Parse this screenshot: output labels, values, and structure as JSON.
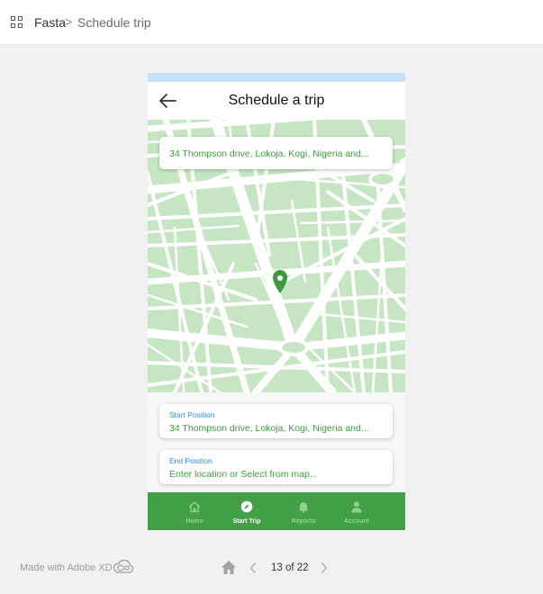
{
  "breadcrumb": {
    "root": "Fasta",
    "separator": ">",
    "current": "Schedule trip"
  },
  "screen": {
    "title": "Schedule a trip",
    "search_value": "34 Thompson drive, Lokoja, Kogi, Nigeria and...",
    "start": {
      "label": "Start Position",
      "value": "34 Thompson drive, Lokoja, Kogi, Nigeria and..."
    },
    "end": {
      "label": "End Position",
      "placeholder": "Enter location or Select from map..."
    }
  },
  "nav": [
    {
      "label": "Home",
      "icon": "home-icon",
      "active": false
    },
    {
      "label": "Start Trip",
      "icon": "compass-icon",
      "active": true
    },
    {
      "label": "Reports",
      "icon": "bell-icon",
      "active": false
    },
    {
      "label": "Account",
      "icon": "person-icon",
      "active": false
    }
  ],
  "footer": {
    "brand": "Made with Adobe XD",
    "page_indicator": "13 of 22"
  },
  "colors": {
    "primary_green": "#43a047",
    "map_block": "#c6e6c3",
    "map_road": "#ffffff",
    "label_blue": "#2f8be0",
    "status_bar": "#c4e1f8"
  }
}
